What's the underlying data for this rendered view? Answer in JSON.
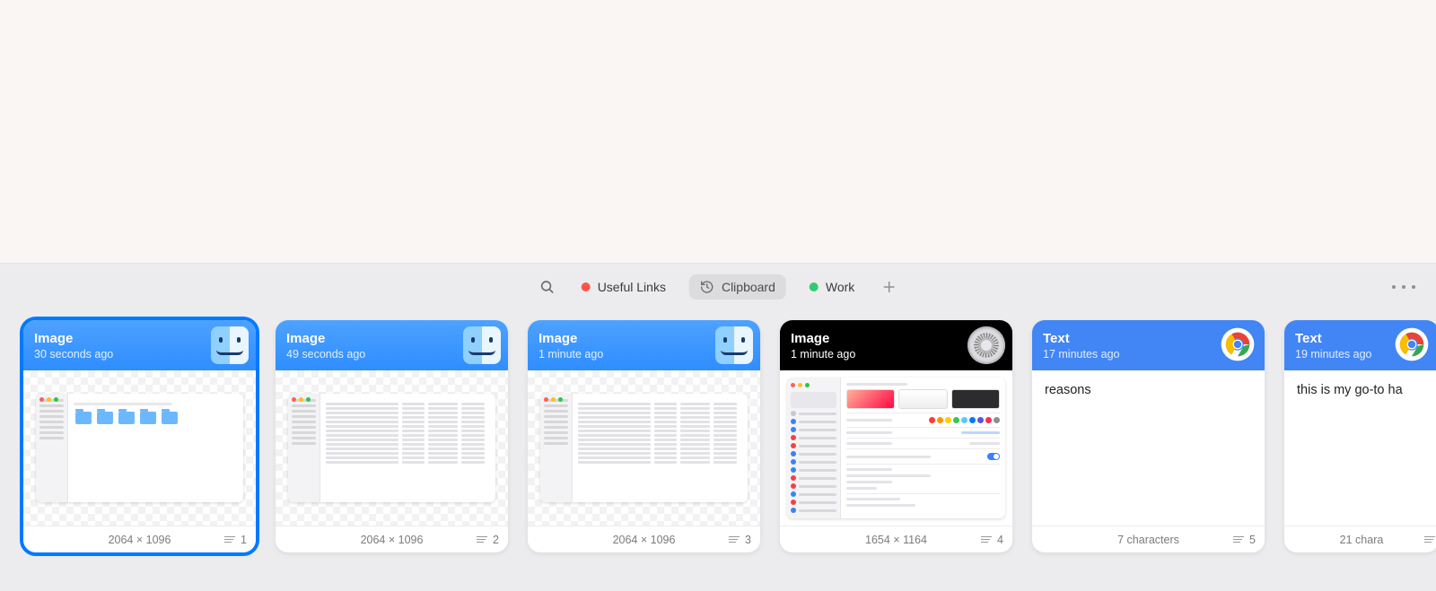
{
  "toolbar": {
    "tabs": [
      {
        "label": "Useful Links",
        "dot": "red"
      },
      {
        "label": "Clipboard",
        "active": true
      },
      {
        "label": "Work",
        "dot": "green"
      }
    ]
  },
  "cards": [
    {
      "type": "Image",
      "time": "30 seconds ago",
      "app": "finder",
      "header": "blue",
      "footer_center": "2064 × 1096",
      "footer_badge": "1",
      "selected": true,
      "preview": "finder-folders"
    },
    {
      "type": "Image",
      "time": "49 seconds ago",
      "app": "finder",
      "header": "blue",
      "footer_center": "2064 × 1096",
      "footer_badge": "2",
      "preview": "finder-list"
    },
    {
      "type": "Image",
      "time": "1 minute ago",
      "app": "finder",
      "header": "blue",
      "footer_center": "2064 × 1096",
      "footer_badge": "3",
      "preview": "finder-list"
    },
    {
      "type": "Image",
      "time": "1 minute ago",
      "app": "settings",
      "header": "dark",
      "footer_center": "1654 × 1164",
      "footer_badge": "4",
      "preview": "settings"
    },
    {
      "type": "Text",
      "time": "17 minutes ago",
      "app": "chrome",
      "header": "google",
      "text": "reasons",
      "footer_center": "7 characters",
      "footer_badge": "5"
    },
    {
      "type": "Text",
      "time": "19 minutes ago",
      "app": "chrome",
      "header": "google",
      "text": "this is my go-to ha",
      "footer_center": "21 chara",
      "cut": true
    }
  ]
}
